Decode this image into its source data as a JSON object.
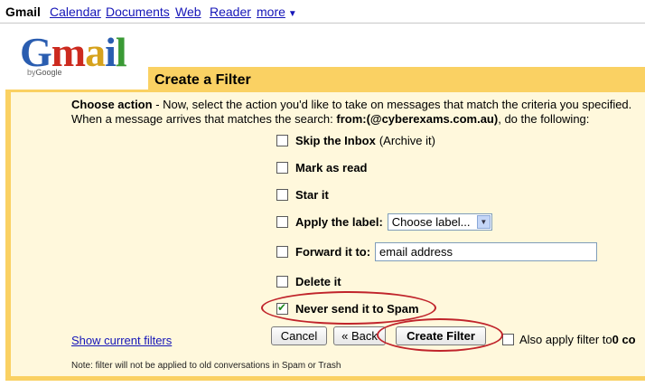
{
  "topnav": {
    "brand": "Gmail",
    "links": [
      "Calendar",
      "Documents",
      "Web",
      "Reader",
      "more"
    ],
    "more_arrow": "▼"
  },
  "logo": {
    "letters": [
      "G",
      "m",
      "a",
      "i",
      "l"
    ],
    "by": "by",
    "google": "Google"
  },
  "panel": {
    "title": "Create a Filter",
    "intro_label": "Choose action",
    "intro_text": " - Now, select the action you'd like to take on messages that match the criteria you specified.",
    "intro_line2_prefix": "When a message arrives that matches the search: ",
    "intro_query": "from:(@cyberexams.com.au)",
    "intro_line2_suffix": ", do the following:"
  },
  "options": {
    "skip_inbox": {
      "label": "Skip the Inbox",
      "note": "(Archive it)",
      "checked": false
    },
    "mark_read": {
      "label": "Mark as read",
      "checked": false
    },
    "star": {
      "label": "Star it",
      "checked": false
    },
    "apply_label": {
      "label": "Apply the label:",
      "select_value": "Choose label...",
      "checked": false
    },
    "forward": {
      "label": "Forward it to:",
      "input_value": "email address",
      "checked": false
    },
    "delete": {
      "label": "Delete it",
      "checked": false
    },
    "never_spam": {
      "label": "Never send it to Spam",
      "checked": true
    }
  },
  "actions": {
    "show_filters": "Show current filters",
    "cancel": "Cancel",
    "back": "« Back",
    "create": "Create Filter",
    "also_apply": "Also apply filter to ",
    "also_apply_count": "0 co"
  },
  "footnote": "Note: filter will not be applied to old conversations in Spam or Trash",
  "colors": {
    "frame": "#fad163",
    "panel": "#fff8dc",
    "link": "#1515b8",
    "annotation": "#c0242b"
  }
}
